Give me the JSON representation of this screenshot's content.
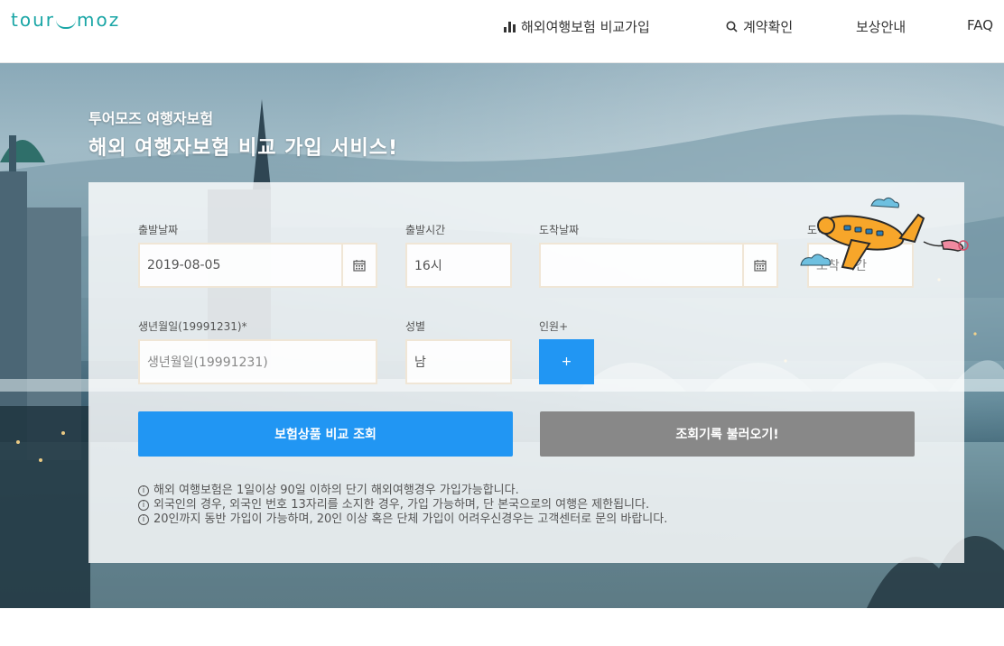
{
  "header": {
    "logo_left": "tour",
    "logo_right": "moz",
    "nav": {
      "compare": "해외여행보험 비교가입",
      "contract": "계약확인",
      "claim": "보상안내",
      "faq": "FAQ"
    }
  },
  "hero": {
    "subtitle": "투어모즈 여행자보험",
    "title": "해외 여행자보험 비교 가입 서비스!"
  },
  "form": {
    "departure_date": {
      "label": "출발날짜",
      "value": "2019-08-05"
    },
    "departure_time": {
      "label": "출발시간",
      "value": "16시"
    },
    "arrival_date": {
      "label": "도착날짜",
      "value": ""
    },
    "arrival_time": {
      "label": "도착시간",
      "value": "도착 시간"
    },
    "birth": {
      "label": "생년월일(19991231)*",
      "placeholder": "생년월일(19991231)"
    },
    "gender": {
      "label": "성별",
      "value": "남"
    },
    "people": {
      "label": "인원+",
      "button": "+"
    },
    "search_button": "보험상품 비교 조회",
    "history_button": "조회기록 불러오기!"
  },
  "notes": [
    "해외 여행보험은 1일이상 90일 이하의 단기 해외여행경우 가입가능합니다.",
    "외국인의 경우, 외국인 번호 13자리를 소지한 경우, 가입 가능하며, 단 본국으로의 여행은 제한됩니다.",
    "20인까지 동반 가입이 가능하며, 20인 이상 혹은 단체 가입이 어려우신경우는 고객센터로 문의 바랍니다."
  ],
  "icons": {
    "chart": "bar-chart-icon",
    "search": "search-icon",
    "calendar": "calendar-icon",
    "info": "info-icon",
    "airplane": "airplane-illustration"
  },
  "colors": {
    "brand": "#1aa6a6",
    "primary": "#2196f3",
    "secondary": "#888888"
  }
}
